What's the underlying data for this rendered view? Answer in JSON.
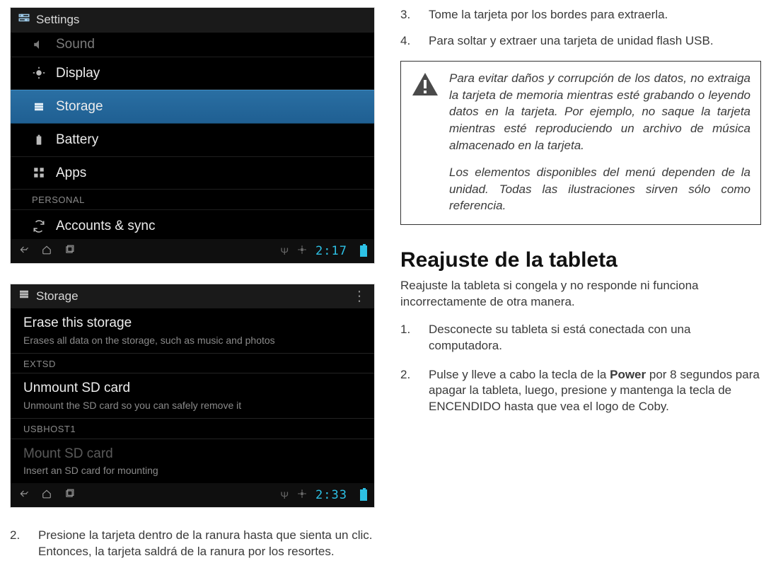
{
  "screenshot1": {
    "header_title": "Settings",
    "items": [
      {
        "icon": "sound-icon",
        "label": "Sound",
        "selected": false
      },
      {
        "icon": "display-icon",
        "label": "Display",
        "selected": false
      },
      {
        "icon": "storage-icon",
        "label": "Storage",
        "selected": true
      },
      {
        "icon": "battery-icon",
        "label": "Battery",
        "selected": false
      },
      {
        "icon": "apps-icon",
        "label": "Apps",
        "selected": false
      }
    ],
    "section_label": "PERSONAL",
    "last_item": {
      "icon": "sync-icon",
      "label": "Accounts & sync"
    },
    "clock": "2:17"
  },
  "screenshot2": {
    "header_title": "Storage",
    "items": [
      {
        "title": "Erase this storage",
        "sub": "Erases all data on the storage, such as music and photos",
        "section": null
      },
      {
        "section": "EXTSD"
      },
      {
        "title": "Unmount SD card",
        "sub": "Unmount the SD card so you can safely remove it"
      },
      {
        "section": "USBHOST1"
      },
      {
        "title": "Mount SD card",
        "sub": "Insert an SD card for mounting",
        "disabled": true
      }
    ],
    "clock": "2:33"
  },
  "left_steps": {
    "2": "Presione la tarjeta dentro de la ranura hasta que sienta un clic. Entonces, la tarjeta saldrá de la ranura por los resortes."
  },
  "right_steps": {
    "3": "Tome la tarjeta por los bordes para extraerla.",
    "4": "Para soltar y extraer una tarjeta de unidad flash USB."
  },
  "warn": {
    "p1": "Para evitar daños y corrupción de los datos, no extraiga la tarjeta de memoria mientras esté grabando o leyendo datos en la tarjeta. Por ejemplo, no saque la tarjeta mientras esté reproduciendo un archivo de música almacenado en la tarjeta.",
    "p2": "Los elementos disponibles del menú dependen de la unidad. Todas las ilustraciones sirven sólo como referencia."
  },
  "reset": {
    "title": "Reajuste de la tableta",
    "intro": "Reajuste la tableta si congela y no responde ni funciona incorrectamente de otra manera.",
    "step1": "Desconecte su tableta si está conectada con una computadora.",
    "step2_pre": "Pulse y lleve a cabo la tecla de la ",
    "step2_bold": "Power",
    "step2_post": " por 8 segundos para apagar la tableta, luego, presione y mantenga la tecla de ENCENDIDO hasta que vea el logo de Coby."
  }
}
